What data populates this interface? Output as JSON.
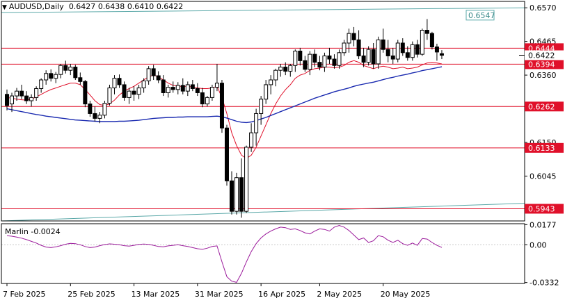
{
  "header": {
    "symbol": "AUDUSD,Daily",
    "open": "0.6427",
    "high": "0.6438",
    "low": "0.6410",
    "close": "0.6422"
  },
  "indicator": {
    "name": "Marlin",
    "value": "-0.0024"
  },
  "chart_data": [
    {
      "type": "candlestick",
      "title": "AUDUSD,Daily",
      "ylim": [
        0.5905,
        0.659
      ],
      "y_ticks": [
        "0.6570",
        "0.6465",
        "0.6360",
        "0.6150",
        "0.6045"
      ],
      "x_tick_labels": [
        "7 Feb 2025",
        "25 Feb 2025",
        "13 Mar 2025",
        "31 Mar 2025",
        "16 Apr 2025",
        "2 May 2025",
        "20 May 2025"
      ],
      "ohlc": [
        [
          0.63,
          0.6315,
          0.625,
          0.6265
        ],
        [
          0.627,
          0.6305,
          0.6245,
          0.6295
        ],
        [
          0.6295,
          0.632,
          0.628,
          0.631
        ],
        [
          0.631,
          0.633,
          0.6285,
          0.6295
        ],
        [
          0.6295,
          0.631,
          0.627,
          0.628
        ],
        [
          0.628,
          0.63,
          0.6262,
          0.629
        ],
        [
          0.629,
          0.6325,
          0.628,
          0.6318
        ],
        [
          0.6318,
          0.635,
          0.6305,
          0.6345
        ],
        [
          0.6345,
          0.6375,
          0.633,
          0.6365
        ],
        [
          0.6365,
          0.6378,
          0.634,
          0.635
        ],
        [
          0.635,
          0.637,
          0.6335,
          0.6362
        ],
        [
          0.6362,
          0.6395,
          0.635,
          0.639
        ],
        [
          0.639,
          0.6405,
          0.6365,
          0.6375
        ],
        [
          0.6375,
          0.6395,
          0.636,
          0.6385
        ],
        [
          0.6385,
          0.6392,
          0.6345,
          0.6352
        ],
        [
          0.6352,
          0.6368,
          0.633,
          0.634
        ],
        [
          0.634,
          0.6345,
          0.626,
          0.627
        ],
        [
          0.627,
          0.628,
          0.623,
          0.624
        ],
        [
          0.624,
          0.6262,
          0.6215,
          0.6225
        ],
        [
          0.6225,
          0.6245,
          0.621,
          0.6235
        ],
        [
          0.6235,
          0.628,
          0.6225,
          0.6272
        ],
        [
          0.6272,
          0.633,
          0.6265,
          0.632
        ],
        [
          0.632,
          0.636,
          0.63,
          0.635
        ],
        [
          0.635,
          0.6362,
          0.632,
          0.633
        ],
        [
          0.633,
          0.634,
          0.628,
          0.629
        ],
        [
          0.629,
          0.632,
          0.627,
          0.631
        ],
        [
          0.631,
          0.6325,
          0.628,
          0.63
        ],
        [
          0.63,
          0.633,
          0.6285,
          0.632
        ],
        [
          0.632,
          0.635,
          0.6305,
          0.6342
        ],
        [
          0.6342,
          0.6388,
          0.633,
          0.638
        ],
        [
          0.638,
          0.6392,
          0.6345,
          0.6358
        ],
        [
          0.6358,
          0.6372,
          0.6335,
          0.6345
        ],
        [
          0.6345,
          0.636,
          0.6295,
          0.6305
        ],
        [
          0.6305,
          0.633,
          0.629,
          0.6322
        ],
        [
          0.6322,
          0.634,
          0.6305,
          0.6315
        ],
        [
          0.6315,
          0.6338,
          0.63,
          0.6328
        ],
        [
          0.6328,
          0.635,
          0.63,
          0.631
        ],
        [
          0.631,
          0.634,
          0.6295,
          0.633
        ],
        [
          0.633,
          0.6345,
          0.631,
          0.6318
        ],
        [
          0.6318,
          0.6335,
          0.6295,
          0.6305
        ],
        [
          0.6305,
          0.632,
          0.626,
          0.627
        ],
        [
          0.627,
          0.6295,
          0.6262,
          0.629
        ],
        [
          0.629,
          0.633,
          0.628,
          0.6322
        ],
        [
          0.6322,
          0.6395,
          0.631,
          0.6335
        ],
        [
          0.6335,
          0.6345,
          0.618,
          0.6195
        ],
        [
          0.6195,
          0.6205,
          0.6015,
          0.603
        ],
        [
          0.603,
          0.606,
          0.5925,
          0.5935
        ],
        [
          0.5935,
          0.6055,
          0.5925,
          0.604
        ],
        [
          0.604,
          0.61,
          0.5915,
          0.5935
        ],
        [
          0.5935,
          0.614,
          0.593,
          0.6135
        ],
        [
          0.6135,
          0.621,
          0.612,
          0.618
        ],
        [
          0.618,
          0.6255,
          0.614,
          0.624
        ],
        [
          0.624,
          0.6295,
          0.6205,
          0.6285
        ],
        [
          0.6285,
          0.6345,
          0.627,
          0.633
        ],
        [
          0.633,
          0.636,
          0.63,
          0.6345
        ],
        [
          0.6345,
          0.638,
          0.6325,
          0.6375
        ],
        [
          0.6375,
          0.6395,
          0.6355,
          0.6385
        ],
        [
          0.6385,
          0.64,
          0.636,
          0.6372
        ],
        [
          0.6372,
          0.6395,
          0.6355,
          0.639
        ],
        [
          0.639,
          0.644,
          0.637,
          0.6435
        ],
        [
          0.6435,
          0.6445,
          0.639,
          0.6405
        ],
        [
          0.6405,
          0.642,
          0.637,
          0.6378
        ],
        [
          0.6378,
          0.6435,
          0.636,
          0.6425
        ],
        [
          0.6425,
          0.644,
          0.6385,
          0.64
        ],
        [
          0.64,
          0.642,
          0.6375,
          0.6385
        ],
        [
          0.6385,
          0.643,
          0.637,
          0.642
        ],
        [
          0.642,
          0.6445,
          0.6395,
          0.641
        ],
        [
          0.641,
          0.6425,
          0.638,
          0.639
        ],
        [
          0.639,
          0.644,
          0.638,
          0.643
        ],
        [
          0.643,
          0.647,
          0.642,
          0.646
        ],
        [
          0.646,
          0.6505,
          0.643,
          0.649
        ],
        [
          0.649,
          0.651,
          0.645,
          0.647
        ],
        [
          0.647,
          0.65,
          0.641,
          0.642
        ],
        [
          0.642,
          0.6445,
          0.6385,
          0.64
        ],
        [
          0.64,
          0.645,
          0.639,
          0.644
        ],
        [
          0.644,
          0.646,
          0.638,
          0.6395
        ],
        [
          0.6395,
          0.648,
          0.638,
          0.647
        ],
        [
          0.647,
          0.6505,
          0.643,
          0.644
        ],
        [
          0.644,
          0.647,
          0.64,
          0.642
        ],
        [
          0.642,
          0.6445,
          0.6395,
          0.641
        ],
        [
          0.641,
          0.647,
          0.64,
          0.646
        ],
        [
          0.646,
          0.6475,
          0.642,
          0.643
        ],
        [
          0.643,
          0.645,
          0.6405,
          0.6415
        ],
        [
          0.6415,
          0.6465,
          0.6405,
          0.6455
        ],
        [
          0.6455,
          0.647,
          0.6415,
          0.6425
        ],
        [
          0.6425,
          0.6505,
          0.642,
          0.65
        ],
        [
          0.65,
          0.6535,
          0.647,
          0.649
        ],
        [
          0.649,
          0.6495,
          0.644,
          0.6448
        ],
        [
          0.6448,
          0.6458,
          0.6405,
          0.6432
        ],
        [
          0.6427,
          0.6438,
          0.641,
          0.6422
        ]
      ],
      "ma_red": [
        0.629,
        0.6288,
        0.6285,
        0.6283,
        0.6282,
        0.6285,
        0.6292,
        0.63,
        0.6308,
        0.6315,
        0.632,
        0.6325,
        0.633,
        0.6335,
        0.6335,
        0.633,
        0.6315,
        0.6298,
        0.628,
        0.6268,
        0.6265,
        0.627,
        0.6282,
        0.6298,
        0.631,
        0.6318,
        0.6325,
        0.6335,
        0.6345,
        0.6355,
        0.636,
        0.6355,
        0.6345,
        0.6335,
        0.6328,
        0.6325,
        0.6325,
        0.6325,
        0.6323,
        0.632,
        0.6318,
        0.6318,
        0.632,
        0.6325,
        0.629,
        0.624,
        0.618,
        0.614,
        0.611,
        0.61,
        0.611,
        0.6135,
        0.617,
        0.6205,
        0.624,
        0.627,
        0.6295,
        0.6315,
        0.633,
        0.635,
        0.636,
        0.6365,
        0.6375,
        0.638,
        0.6382,
        0.6385,
        0.6385,
        0.6383,
        0.6385,
        0.639,
        0.64,
        0.6405,
        0.64,
        0.639,
        0.6385,
        0.638,
        0.6385,
        0.6388,
        0.6385,
        0.638,
        0.6382,
        0.6385,
        0.638,
        0.6382,
        0.6385,
        0.6392,
        0.6398,
        0.64,
        0.6398,
        0.6395
      ],
      "ma_blue": [
        0.6255,
        0.6252,
        0.6249,
        0.6246,
        0.6243,
        0.624,
        0.6237,
        0.6235,
        0.6232,
        0.623,
        0.6228,
        0.6226,
        0.6224,
        0.6222,
        0.622,
        0.6219,
        0.6218,
        0.6217,
        0.6216,
        0.6215,
        0.6215,
        0.6215,
        0.6215,
        0.6216,
        0.6216,
        0.6217,
        0.6218,
        0.6219,
        0.6221,
        0.6223,
        0.6225,
        0.6226,
        0.6227,
        0.6228,
        0.6228,
        0.6229,
        0.6229,
        0.623,
        0.623,
        0.623,
        0.623,
        0.623,
        0.6231,
        0.6232,
        0.623,
        0.6226,
        0.6221,
        0.6216,
        0.6213,
        0.6212,
        0.6214,
        0.6218,
        0.6223,
        0.6228,
        0.6234,
        0.624,
        0.6246,
        0.6252,
        0.6258,
        0.6264,
        0.627,
        0.6276,
        0.6282,
        0.6288,
        0.6293,
        0.6298,
        0.6303,
        0.6308,
        0.6312,
        0.6316,
        0.632,
        0.6325,
        0.6329,
        0.6332,
        0.6335,
        0.6338,
        0.6342,
        0.6346,
        0.635,
        0.6353,
        0.6357,
        0.636,
        0.6363,
        0.6367,
        0.637,
        0.6374,
        0.6377,
        0.638,
        0.6383,
        0.6386
      ],
      "channel_upper": {
        "start": 0.6555,
        "end": 0.657
      },
      "channel_lower": {
        "start": 0.5905,
        "end": 0.596
      },
      "levels": [
        {
          "value": 0.6444,
          "label": "0.6444"
        },
        {
          "value": 0.6394,
          "label": "0.6394"
        },
        {
          "value": 0.6262,
          "label": "0.6262"
        },
        {
          "value": 0.6133,
          "label": "0.6133"
        },
        {
          "value": 0.5943,
          "label": "0.5943"
        }
      ],
      "price_labels": [
        {
          "value": 0.6422,
          "label": "0.6422"
        },
        {
          "value": 0.6547,
          "label": "0.6547"
        }
      ],
      "colors": {
        "bull": "#ffffff",
        "bear": "#000000",
        "ma_red": "#e0102a",
        "ma_blue": "#1a2ab0",
        "level": "#e0102a",
        "channel": "#5aa8a8"
      }
    },
    {
      "type": "line",
      "series": [
        {
          "name": "Marlin"
        }
      ],
      "ylim": [
        -0.034,
        0.0185
      ],
      "y_ticks": [
        "0.0177",
        "0.00",
        "-0.0332"
      ],
      "values": [
        0.008,
        0.0075,
        0.0068,
        0.0058,
        0.0045,
        0.003,
        0.0015,
        -0.0005,
        -0.002,
        -0.0025,
        -0.0018,
        -0.0008,
        0.0005,
        0.0012,
        0.001,
        0.0,
        -0.0015,
        -0.0025,
        -0.002,
        -0.0008,
        0.0002,
        0.0008,
        0.0005,
        0.0,
        -0.0008,
        -0.0012,
        -0.0005,
        0.0003,
        0.0006,
        0.0003,
        -0.0005,
        -0.0015,
        -0.0018,
        -0.001,
        -0.0005,
        0.0,
        -0.0008,
        -0.0015,
        -0.0025,
        -0.0035,
        -0.004,
        -0.003,
        -0.0015,
        -0.001,
        -0.015,
        -0.028,
        -0.032,
        -0.033,
        -0.025,
        -0.015,
        -0.006,
        0.001,
        0.006,
        0.0095,
        0.012,
        0.014,
        0.0155,
        0.015,
        0.0135,
        0.014,
        0.0125,
        0.0105,
        0.0095,
        0.012,
        0.014,
        0.0135,
        0.012,
        0.0155,
        0.017,
        0.0155,
        0.0125,
        0.0085,
        0.0045,
        0.006,
        0.002,
        0.0035,
        0.008,
        0.007,
        0.004,
        0.002,
        0.004,
        0.001,
        -0.0005,
        0.0015,
        -0.0005,
        0.0055,
        0.005,
        0.002,
        -0.0005,
        -0.0024
      ],
      "color": "#9b1a9b"
    }
  ]
}
